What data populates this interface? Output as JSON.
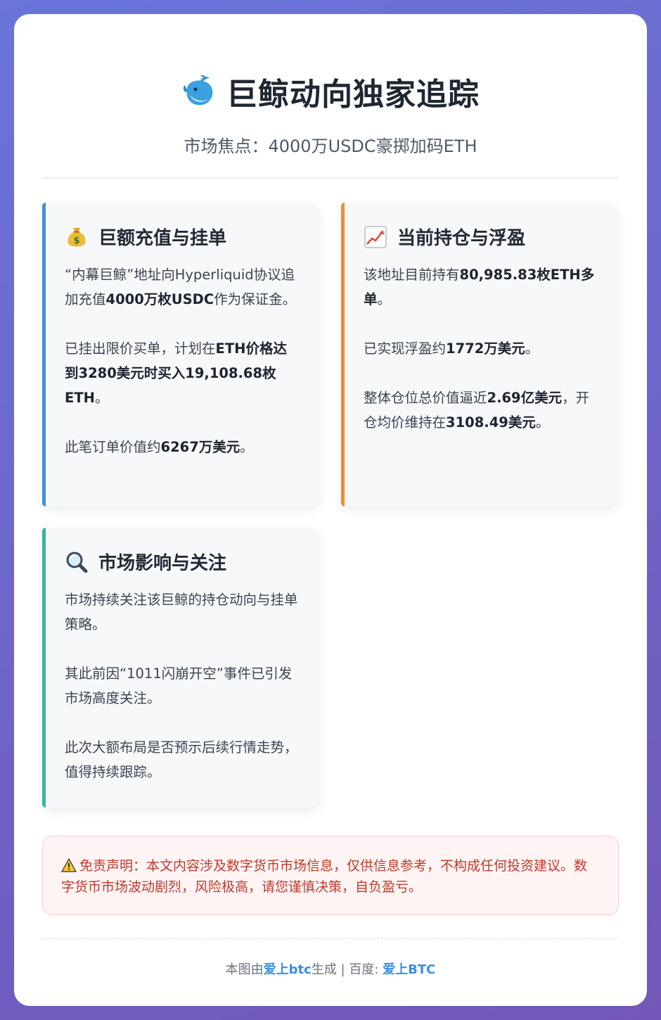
{
  "header": {
    "icon": "whale-icon",
    "title": "巨鲸动向独家追踪",
    "subtitle": "市场焦点：4000万USDC豪掷加码ETH"
  },
  "panels": [
    {
      "icon": "money-bag-icon",
      "title": "巨额充值与挂单",
      "accent": "#3f8fdc",
      "paragraphs": [
        [
          {
            "t": "“内幕巨鲸”地址向Hyperliquid协议追加充值"
          },
          {
            "t": "4000万枚USDC",
            "b": true
          },
          {
            "t": "作为保证金。"
          }
        ],
        [
          {
            "t": "已挂出限价买单，计划在"
          },
          {
            "t": "ETH价格达到3280美元时买入19,108.68枚ETH",
            "b": true
          },
          {
            "t": "。"
          }
        ],
        [
          {
            "t": "此笔订单价值约"
          },
          {
            "t": "6267万美元",
            "b": true
          },
          {
            "t": "。"
          }
        ]
      ]
    },
    {
      "icon": "chart-increasing-icon",
      "title": "当前持仓与浮盈",
      "accent": "#f08c36",
      "paragraphs": [
        [
          {
            "t": "该地址目前持有"
          },
          {
            "t": "80,985.83枚ETH多单",
            "b": true
          },
          {
            "t": "。"
          }
        ],
        [
          {
            "t": "已实现浮盈约"
          },
          {
            "t": "1772万美元",
            "b": true
          },
          {
            "t": "。"
          }
        ],
        [
          {
            "t": "整体仓位总价值逼近"
          },
          {
            "t": "2.69亿美元",
            "b": true
          },
          {
            "t": "，开仓均价维持在"
          },
          {
            "t": "3108.49美元",
            "b": true
          },
          {
            "t": "。"
          }
        ]
      ]
    },
    {
      "icon": "magnifier-icon",
      "title": "市场影响与关注",
      "accent": "#36b3a7",
      "paragraphs": [
        [
          {
            "t": "市场持续关注该巨鲸的持仓动向与挂单策略。"
          }
        ],
        [
          {
            "t": "其此前因“1011闪崩开空”事件已引发市场高度关注。"
          }
        ],
        [
          {
            "t": "此次大额布局是否预示后续行情走势，值得持续跟踪。"
          }
        ]
      ]
    }
  ],
  "disclaimer": {
    "icon": "warning-icon",
    "text": "免责声明：本文内容涉及数字货币市场信息，仅供信息参考，不构成任何投资建议。数字货币市场波动剧烈，风险极高，请您谨慎决策，自负盈亏。"
  },
  "footer": {
    "prefix": "本图由",
    "brand": "爱上btc",
    "middle": "生成 | 百度: ",
    "baidu": "爱上BTC"
  }
}
